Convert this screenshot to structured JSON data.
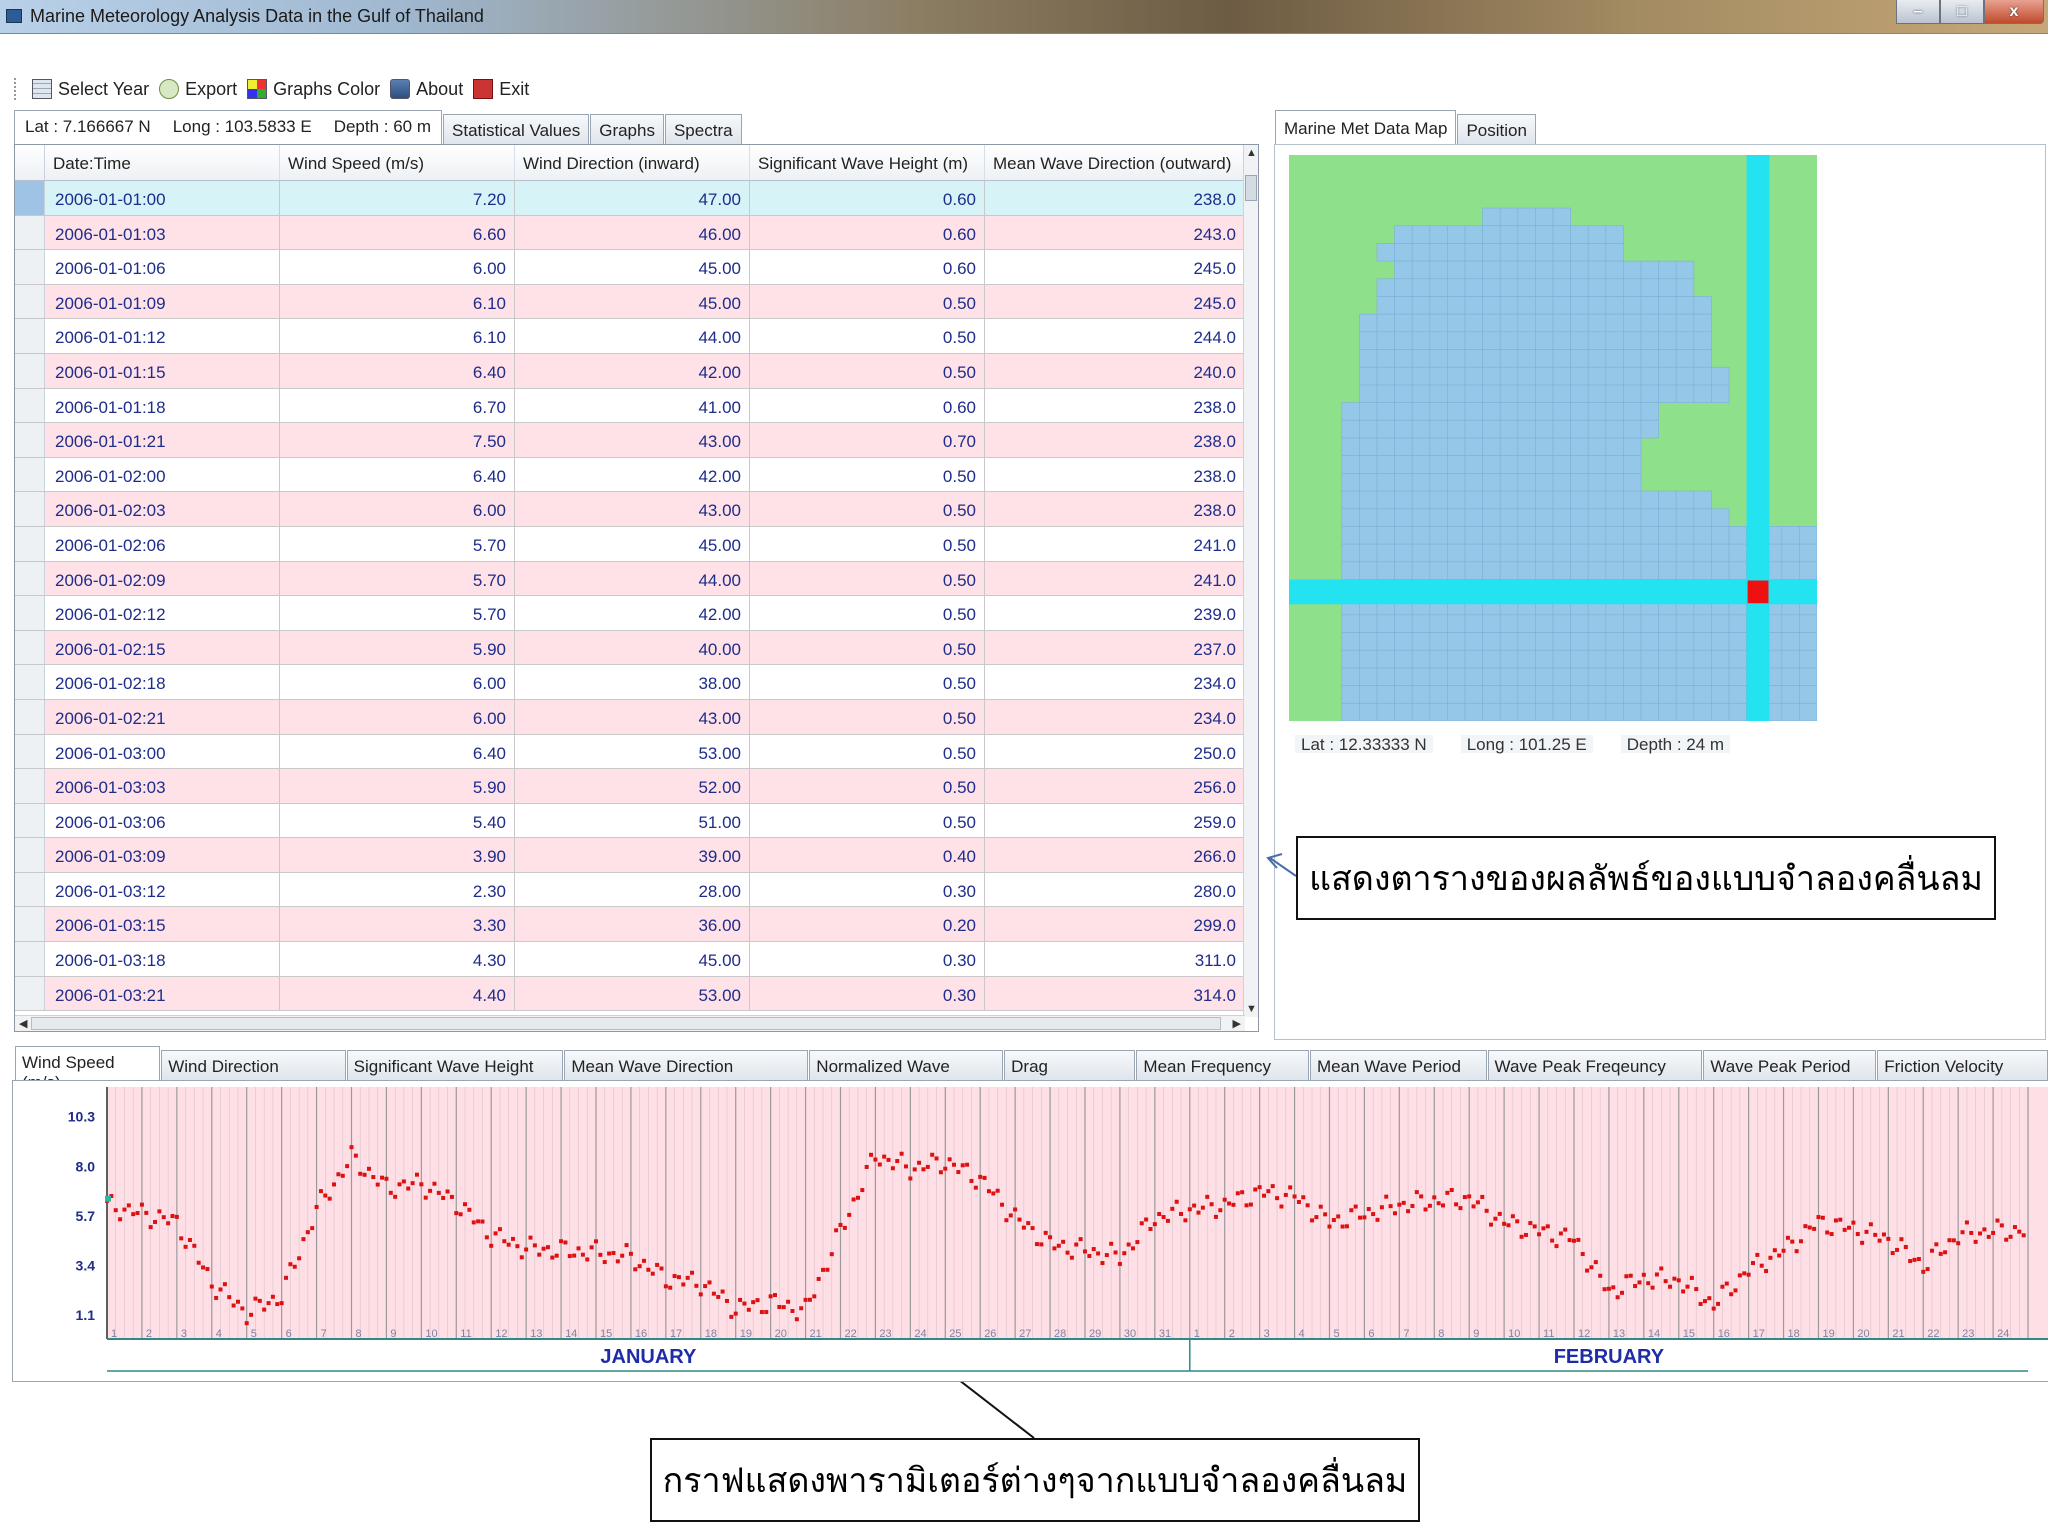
{
  "window": {
    "title": "Marine Meteorology Analysis Data in the Gulf of Thailand",
    "min_glyph": "–",
    "max_glyph": "□",
    "close_glyph": "x"
  },
  "toolbar": {
    "select_year": "Select Year",
    "export": "Export",
    "graphs_color": "Graphs Color",
    "about": "About",
    "exit": "Exit"
  },
  "location": {
    "lat": "Lat : 7.166667 N",
    "long": "Long : 103.5833 E",
    "depth": "Depth : 60 m"
  },
  "tabs": [
    "Statistical Values",
    "Graphs",
    "Spectra"
  ],
  "table": {
    "columns": [
      "Date:Time",
      "Wind Speed (m/s)",
      "Wind Direction (inward)",
      "Significant Wave Height (m)",
      "Mean Wave Direction (outward)"
    ],
    "rows": [
      [
        "2006-01-01:00",
        "7.20",
        "47.00",
        "0.60",
        "238.0"
      ],
      [
        "2006-01-01:03",
        "6.60",
        "46.00",
        "0.60",
        "243.0"
      ],
      [
        "2006-01-01:06",
        "6.00",
        "45.00",
        "0.60",
        "245.0"
      ],
      [
        "2006-01-01:09",
        "6.10",
        "45.00",
        "0.50",
        "245.0"
      ],
      [
        "2006-01-01:12",
        "6.10",
        "44.00",
        "0.50",
        "244.0"
      ],
      [
        "2006-01-01:15",
        "6.40",
        "42.00",
        "0.50",
        "240.0"
      ],
      [
        "2006-01-01:18",
        "6.70",
        "41.00",
        "0.60",
        "238.0"
      ],
      [
        "2006-01-01:21",
        "7.50",
        "43.00",
        "0.70",
        "238.0"
      ],
      [
        "2006-01-02:00",
        "6.40",
        "42.00",
        "0.50",
        "238.0"
      ],
      [
        "2006-01-02:03",
        "6.00",
        "43.00",
        "0.50",
        "238.0"
      ],
      [
        "2006-01-02:06",
        "5.70",
        "45.00",
        "0.50",
        "241.0"
      ],
      [
        "2006-01-02:09",
        "5.70",
        "44.00",
        "0.50",
        "241.0"
      ],
      [
        "2006-01-02:12",
        "5.70",
        "42.00",
        "0.50",
        "239.0"
      ],
      [
        "2006-01-02:15",
        "5.90",
        "40.00",
        "0.50",
        "237.0"
      ],
      [
        "2006-01-02:18",
        "6.00",
        "38.00",
        "0.50",
        "234.0"
      ],
      [
        "2006-01-02:21",
        "6.00",
        "43.00",
        "0.50",
        "234.0"
      ],
      [
        "2006-01-03:00",
        "6.40",
        "53.00",
        "0.50",
        "250.0"
      ],
      [
        "2006-01-03:03",
        "5.90",
        "52.00",
        "0.50",
        "256.0"
      ],
      [
        "2006-01-03:06",
        "5.40",
        "51.00",
        "0.50",
        "259.0"
      ],
      [
        "2006-01-03:09",
        "3.90",
        "39.00",
        "0.40",
        "266.0"
      ],
      [
        "2006-01-03:12",
        "2.30",
        "28.00",
        "0.30",
        "280.0"
      ],
      [
        "2006-01-03:15",
        "3.30",
        "36.00",
        "0.20",
        "299.0"
      ],
      [
        "2006-01-03:18",
        "4.30",
        "45.00",
        "0.30",
        "311.0"
      ],
      [
        "2006-01-03:21",
        "4.40",
        "53.00",
        "0.30",
        "314.0"
      ]
    ]
  },
  "map_tabs": [
    "Marine Met Data Map",
    "Position"
  ],
  "map_info": {
    "lat": "Lat : 12.33333 N",
    "long": "Long : 101.25 E",
    "depth": "Depth : 24 m"
  },
  "colors": {
    "land": "#8fe08b",
    "sea": "#95c8e8",
    "crosshair": "#22e3ef",
    "marker": "#ee1111",
    "chart_point": "#dd1111",
    "chart_bg": "#ffdfe6"
  },
  "callouts": {
    "table": "แสดงตารางของผลลัพธ์ของแบบจำลองคลื่นลม",
    "graph": "กราฟแสดงพารามิเตอร์ต่างๆจากแบบจำลองคลื่นลม"
  },
  "graph_tabs": [
    "Wind Speed (m/s)",
    "Wind Direction (inward)",
    "Significant Wave Height (m)",
    "Mean Wave Direction (outward)",
    "Normalized Wave Stress",
    "Drag Coefficient",
    "Mean Frequency (Hz)",
    "Mean Wave Period (s)",
    "Wave Peak Freqeuncy (Hz)",
    "Wave Peak Period (s)",
    "Friction Velocity (m/s)"
  ],
  "chart_data": {
    "type": "scatter",
    "y_ticks": [
      "10.3",
      "8.0",
      "5.7",
      "3.4",
      "1.1"
    ],
    "y_tick_values": [
      10.3,
      8.0,
      5.7,
      3.4,
      1.1
    ],
    "ylim": [
      0,
      11.3
    ],
    "months": [
      {
        "name": "JANUARY",
        "days": 31
      },
      {
        "name": "FEBRUARY",
        "days": 24
      }
    ],
    "daily_wind_speed": [
      6.2,
      5.8,
      5.4,
      2.6,
      1.2,
      2.0,
      6.0,
      8.4,
      7.0,
      7.2,
      6.3,
      4.8,
      4.2,
      4.1,
      4.0,
      3.8,
      2.8,
      2.6,
      1.4,
      1.7,
      1.3,
      5.0,
      8.5,
      7.9,
      8.2,
      7.4,
      5.6,
      4.4,
      4.1,
      3.8,
      5.6,
      6.0,
      6.2,
      6.8,
      6.6,
      5.4,
      5.8,
      6.2,
      6.4,
      6.5,
      5.4,
      5.0,
      4.6,
      2.2,
      2.8,
      2.7,
      1.6,
      3.2,
      4.1,
      5.4,
      5.1,
      4.6,
      3.4,
      4.8,
      5.0
    ],
    "series": [
      {
        "values_note_free": true,
        "x_days": [
          1,
          2,
          3,
          4,
          5,
          6,
          7,
          8,
          9,
          10,
          11,
          12,
          13,
          14,
          15,
          16,
          17,
          18,
          19,
          20,
          21,
          22,
          23,
          24,
          25,
          26,
          27,
          28,
          29,
          30,
          31,
          32,
          33,
          34,
          35,
          36,
          37,
          38,
          39,
          40,
          41,
          42,
          43,
          44,
          45,
          46,
          47,
          48,
          49,
          50,
          51,
          52,
          53,
          54,
          55
        ]
      }
    ]
  }
}
